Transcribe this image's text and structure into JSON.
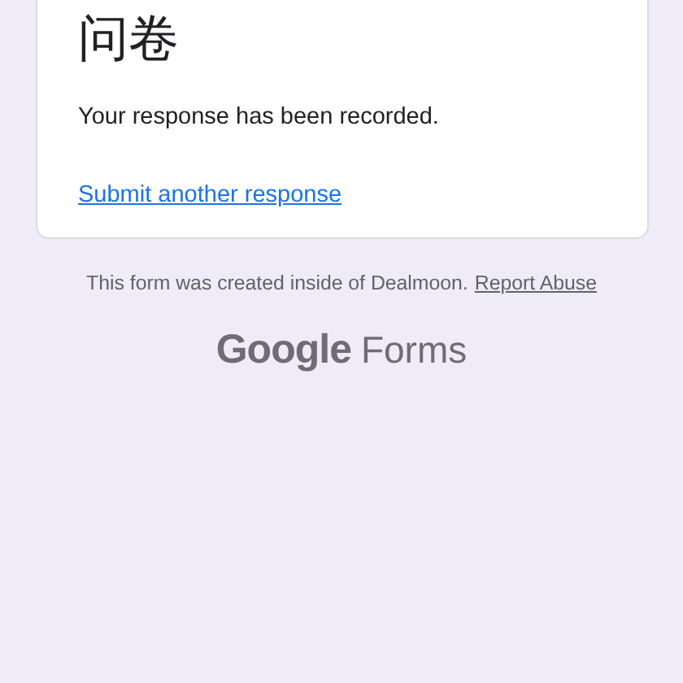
{
  "card": {
    "title": "问卷",
    "message": "Your response has been recorded.",
    "link": "Submit another response"
  },
  "footer": {
    "notice": "This form was created inside of Dealmoon.",
    "report_link": "Report Abuse"
  },
  "logo": {
    "brand": "Google",
    "product": "Forms"
  }
}
